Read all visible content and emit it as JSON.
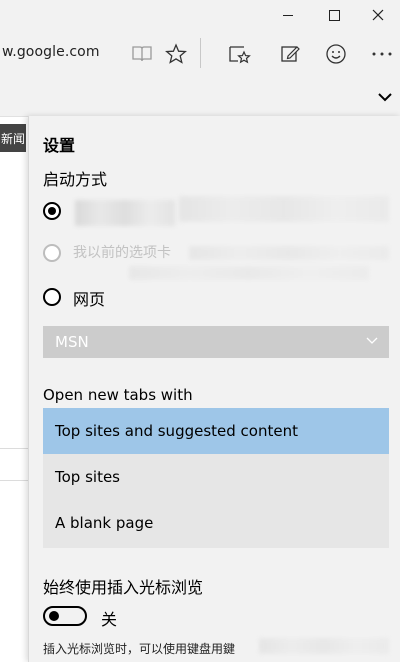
{
  "window": {
    "minimize_label": "minimize",
    "maximize_label": "maximize",
    "close_label": "close"
  },
  "addressbar": {
    "url": "w.google.com",
    "icons": [
      "reading-view-icon",
      "favorite-star-icon",
      "hub-icon",
      "web-note-icon",
      "feedback-smiley-icon",
      "more-icon"
    ]
  },
  "page": {
    "side_tag": "新闻"
  },
  "settings": {
    "title": "设置",
    "startup_label": "启动方式",
    "startup_options": [
      {
        "label": "",
        "checked": true,
        "disabled": false
      },
      {
        "label": "我以前的选项卡",
        "checked": false,
        "disabled": true
      },
      {
        "label": "网页",
        "checked": false,
        "disabled": false
      }
    ],
    "homepage_select": "MSN",
    "newtab_label": "Open new tabs with",
    "newtab_options": [
      {
        "label": "Top sites and suggested content",
        "selected": true
      },
      {
        "label": "Top sites",
        "selected": false
      },
      {
        "label": "A blank page",
        "selected": false
      }
    ],
    "caret_label": "始终使用插入光标浏览",
    "caret_toggle": "关",
    "caret_toggle_on": false,
    "caret_note": "插入光标浏览时，可以使用键盘用鍵"
  }
}
